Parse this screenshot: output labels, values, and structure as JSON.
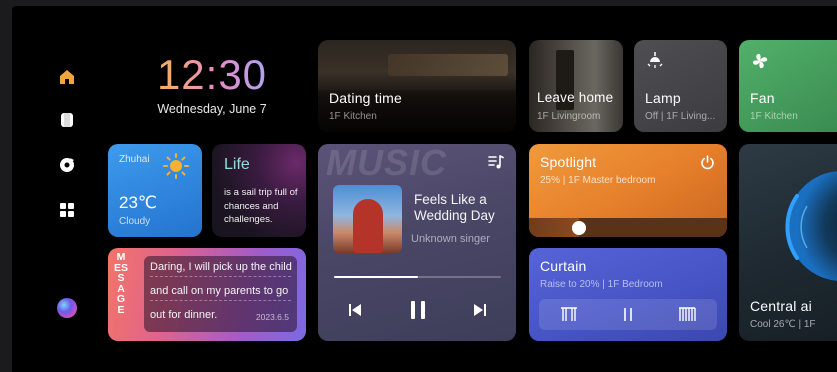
{
  "clock": {
    "time": "12:30",
    "date": "Wednesday, June 7"
  },
  "nav": {
    "items": [
      "home-icon",
      "device-icon",
      "music-disc-icon",
      "grid-icon"
    ]
  },
  "weather": {
    "city": "Zhuhai",
    "temp": "23℃",
    "condition": "Cloudy"
  },
  "life": {
    "title": "Life",
    "text": "is a sail trip full of chances and challenges."
  },
  "message": {
    "vertical_label": "MESSAGE",
    "lines": [
      "Daring, I will pick up the child",
      "and call on my parents to go",
      "out for dinner."
    ],
    "date": "2023.6.5"
  },
  "scenes": [
    {
      "title": "Dating time",
      "sub": "1F Kitchen"
    },
    {
      "title": "Leave home",
      "sub": "1F Livingroom"
    }
  ],
  "lamp": {
    "title": "Lamp",
    "sub": "Off | 1F Living..."
  },
  "fan": {
    "title": "Fan",
    "sub": "1F Kitchen"
  },
  "music": {
    "watermark": "MUSIC",
    "song": "Feels Like a Wedding Day",
    "artist": "Unknown singer",
    "progress": 0.5
  },
  "spotlight": {
    "title": "Spotlight",
    "sub": "25% | 1F Master bedroom",
    "level": 0.25
  },
  "curtain": {
    "title": "Curtain",
    "sub": "Raise to 20% | 1F Bedroom"
  },
  "central_ai": {
    "title": "Central ai",
    "sub": "Cool 26℃ | 1F"
  },
  "colors": {
    "weather": "#2f86dd",
    "spotlight": "#e8862a",
    "curtain": "#4a5ad0",
    "fan": "#3fa25a",
    "message": "#e96a6e"
  }
}
